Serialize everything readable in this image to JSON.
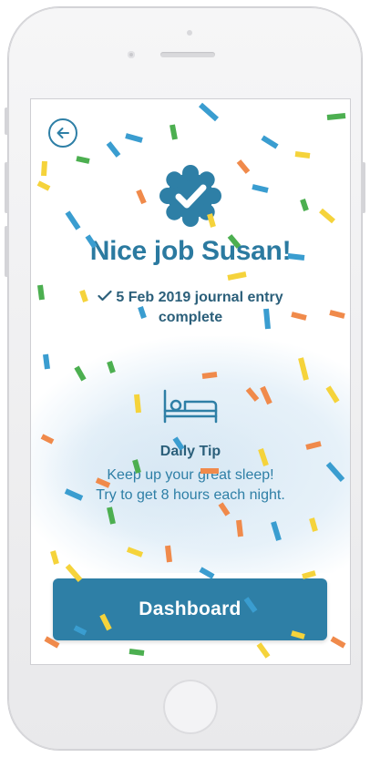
{
  "screen": {
    "title": "Nice job Susan!",
    "entry_line_1": "5 Feb 2019 journal entry",
    "entry_line_2": "complete",
    "tip": {
      "title": "Daily Tip",
      "line_1": "Keep up your great sleep!",
      "line_2": "Try to get 8 hours each night."
    },
    "dashboard_label": "Dashboard"
  },
  "icons": {
    "back": "back-arrow-icon",
    "badge": "verified-check-badge-icon",
    "entry": "checkmark-icon",
    "tip": "bed-icon"
  },
  "colors": {
    "primary": "#2e7fa6",
    "dark_text": "#2b5f7a",
    "confetti": [
      "#3a9dd0",
      "#f08a4b",
      "#4caf50",
      "#f5d33b",
      "#2e7fa6"
    ]
  }
}
